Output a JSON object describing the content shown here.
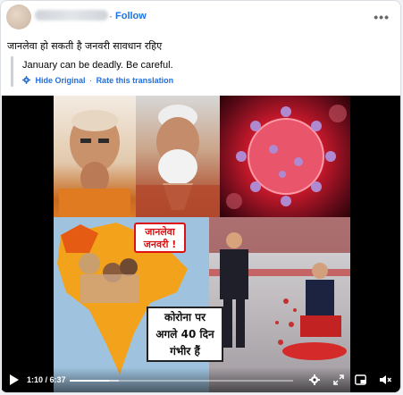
{
  "post": {
    "follow_label": "Follow",
    "separator": "·",
    "more_label": "•••",
    "text": "जानलेवा हो सकती है जनवरी सावधान रहिए"
  },
  "translation": {
    "text": "January can be deadly. Be careful.",
    "hide_label": "Hide Original",
    "link_separator": "·",
    "rate_label": "Rate this translation"
  },
  "video": {
    "banner_text": [
      "जानलेवा",
      "जनवरी !"
    ],
    "overlay_text": [
      "कोरोना पर",
      "अगले 40 दिन",
      "गंभीर हैं"
    ],
    "time": "1:10 / 6:37",
    "progress": 0.176,
    "buffered": 0.22
  },
  "colors": {
    "accent": "#1b74e4",
    "link": "#216fdb",
    "alert": "#dd1111"
  },
  "icons": {
    "more": "more-dots-icon",
    "gear": "gear-icon",
    "play": "play-icon",
    "settings": "settings-icon",
    "fullscreen": "expand-icon",
    "pip": "picture-in-picture-icon",
    "mute": "mute-icon"
  }
}
